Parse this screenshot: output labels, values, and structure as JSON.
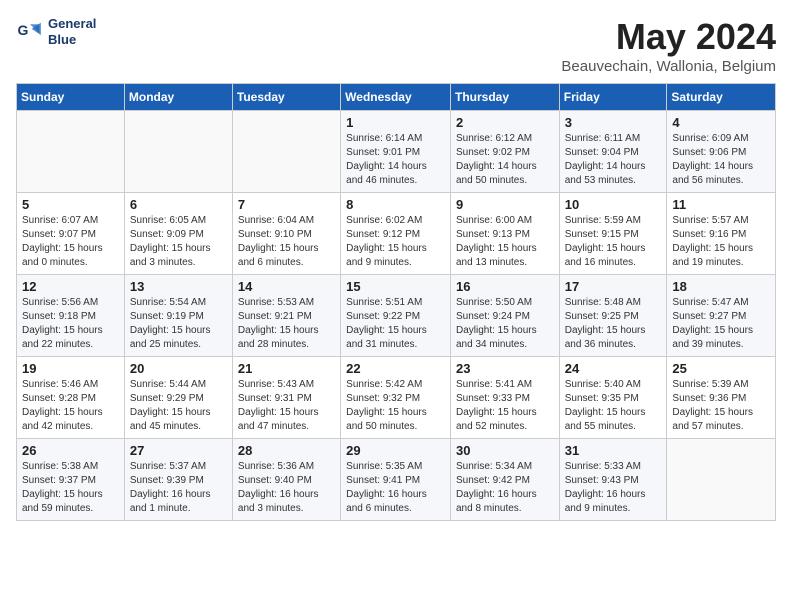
{
  "header": {
    "logo_line1": "General",
    "logo_line2": "Blue",
    "month_year": "May 2024",
    "location": "Beauvechain, Wallonia, Belgium"
  },
  "days_of_week": [
    "Sunday",
    "Monday",
    "Tuesday",
    "Wednesday",
    "Thursday",
    "Friday",
    "Saturday"
  ],
  "weeks": [
    [
      {
        "day": "",
        "text": ""
      },
      {
        "day": "",
        "text": ""
      },
      {
        "day": "",
        "text": ""
      },
      {
        "day": "1",
        "text": "Sunrise: 6:14 AM\nSunset: 9:01 PM\nDaylight: 14 hours and 46 minutes."
      },
      {
        "day": "2",
        "text": "Sunrise: 6:12 AM\nSunset: 9:02 PM\nDaylight: 14 hours and 50 minutes."
      },
      {
        "day": "3",
        "text": "Sunrise: 6:11 AM\nSunset: 9:04 PM\nDaylight: 14 hours and 53 minutes."
      },
      {
        "day": "4",
        "text": "Sunrise: 6:09 AM\nSunset: 9:06 PM\nDaylight: 14 hours and 56 minutes."
      }
    ],
    [
      {
        "day": "5",
        "text": "Sunrise: 6:07 AM\nSunset: 9:07 PM\nDaylight: 15 hours and 0 minutes."
      },
      {
        "day": "6",
        "text": "Sunrise: 6:05 AM\nSunset: 9:09 PM\nDaylight: 15 hours and 3 minutes."
      },
      {
        "day": "7",
        "text": "Sunrise: 6:04 AM\nSunset: 9:10 PM\nDaylight: 15 hours and 6 minutes."
      },
      {
        "day": "8",
        "text": "Sunrise: 6:02 AM\nSunset: 9:12 PM\nDaylight: 15 hours and 9 minutes."
      },
      {
        "day": "9",
        "text": "Sunrise: 6:00 AM\nSunset: 9:13 PM\nDaylight: 15 hours and 13 minutes."
      },
      {
        "day": "10",
        "text": "Sunrise: 5:59 AM\nSunset: 9:15 PM\nDaylight: 15 hours and 16 minutes."
      },
      {
        "day": "11",
        "text": "Sunrise: 5:57 AM\nSunset: 9:16 PM\nDaylight: 15 hours and 19 minutes."
      }
    ],
    [
      {
        "day": "12",
        "text": "Sunrise: 5:56 AM\nSunset: 9:18 PM\nDaylight: 15 hours and 22 minutes."
      },
      {
        "day": "13",
        "text": "Sunrise: 5:54 AM\nSunset: 9:19 PM\nDaylight: 15 hours and 25 minutes."
      },
      {
        "day": "14",
        "text": "Sunrise: 5:53 AM\nSunset: 9:21 PM\nDaylight: 15 hours and 28 minutes."
      },
      {
        "day": "15",
        "text": "Sunrise: 5:51 AM\nSunset: 9:22 PM\nDaylight: 15 hours and 31 minutes."
      },
      {
        "day": "16",
        "text": "Sunrise: 5:50 AM\nSunset: 9:24 PM\nDaylight: 15 hours and 34 minutes."
      },
      {
        "day": "17",
        "text": "Sunrise: 5:48 AM\nSunset: 9:25 PM\nDaylight: 15 hours and 36 minutes."
      },
      {
        "day": "18",
        "text": "Sunrise: 5:47 AM\nSunset: 9:27 PM\nDaylight: 15 hours and 39 minutes."
      }
    ],
    [
      {
        "day": "19",
        "text": "Sunrise: 5:46 AM\nSunset: 9:28 PM\nDaylight: 15 hours and 42 minutes."
      },
      {
        "day": "20",
        "text": "Sunrise: 5:44 AM\nSunset: 9:29 PM\nDaylight: 15 hours and 45 minutes."
      },
      {
        "day": "21",
        "text": "Sunrise: 5:43 AM\nSunset: 9:31 PM\nDaylight: 15 hours and 47 minutes."
      },
      {
        "day": "22",
        "text": "Sunrise: 5:42 AM\nSunset: 9:32 PM\nDaylight: 15 hours and 50 minutes."
      },
      {
        "day": "23",
        "text": "Sunrise: 5:41 AM\nSunset: 9:33 PM\nDaylight: 15 hours and 52 minutes."
      },
      {
        "day": "24",
        "text": "Sunrise: 5:40 AM\nSunset: 9:35 PM\nDaylight: 15 hours and 55 minutes."
      },
      {
        "day": "25",
        "text": "Sunrise: 5:39 AM\nSunset: 9:36 PM\nDaylight: 15 hours and 57 minutes."
      }
    ],
    [
      {
        "day": "26",
        "text": "Sunrise: 5:38 AM\nSunset: 9:37 PM\nDaylight: 15 hours and 59 minutes."
      },
      {
        "day": "27",
        "text": "Sunrise: 5:37 AM\nSunset: 9:39 PM\nDaylight: 16 hours and 1 minute."
      },
      {
        "day": "28",
        "text": "Sunrise: 5:36 AM\nSunset: 9:40 PM\nDaylight: 16 hours and 3 minutes."
      },
      {
        "day": "29",
        "text": "Sunrise: 5:35 AM\nSunset: 9:41 PM\nDaylight: 16 hours and 6 minutes."
      },
      {
        "day": "30",
        "text": "Sunrise: 5:34 AM\nSunset: 9:42 PM\nDaylight: 16 hours and 8 minutes."
      },
      {
        "day": "31",
        "text": "Sunrise: 5:33 AM\nSunset: 9:43 PM\nDaylight: 16 hours and 9 minutes."
      },
      {
        "day": "",
        "text": ""
      }
    ]
  ]
}
